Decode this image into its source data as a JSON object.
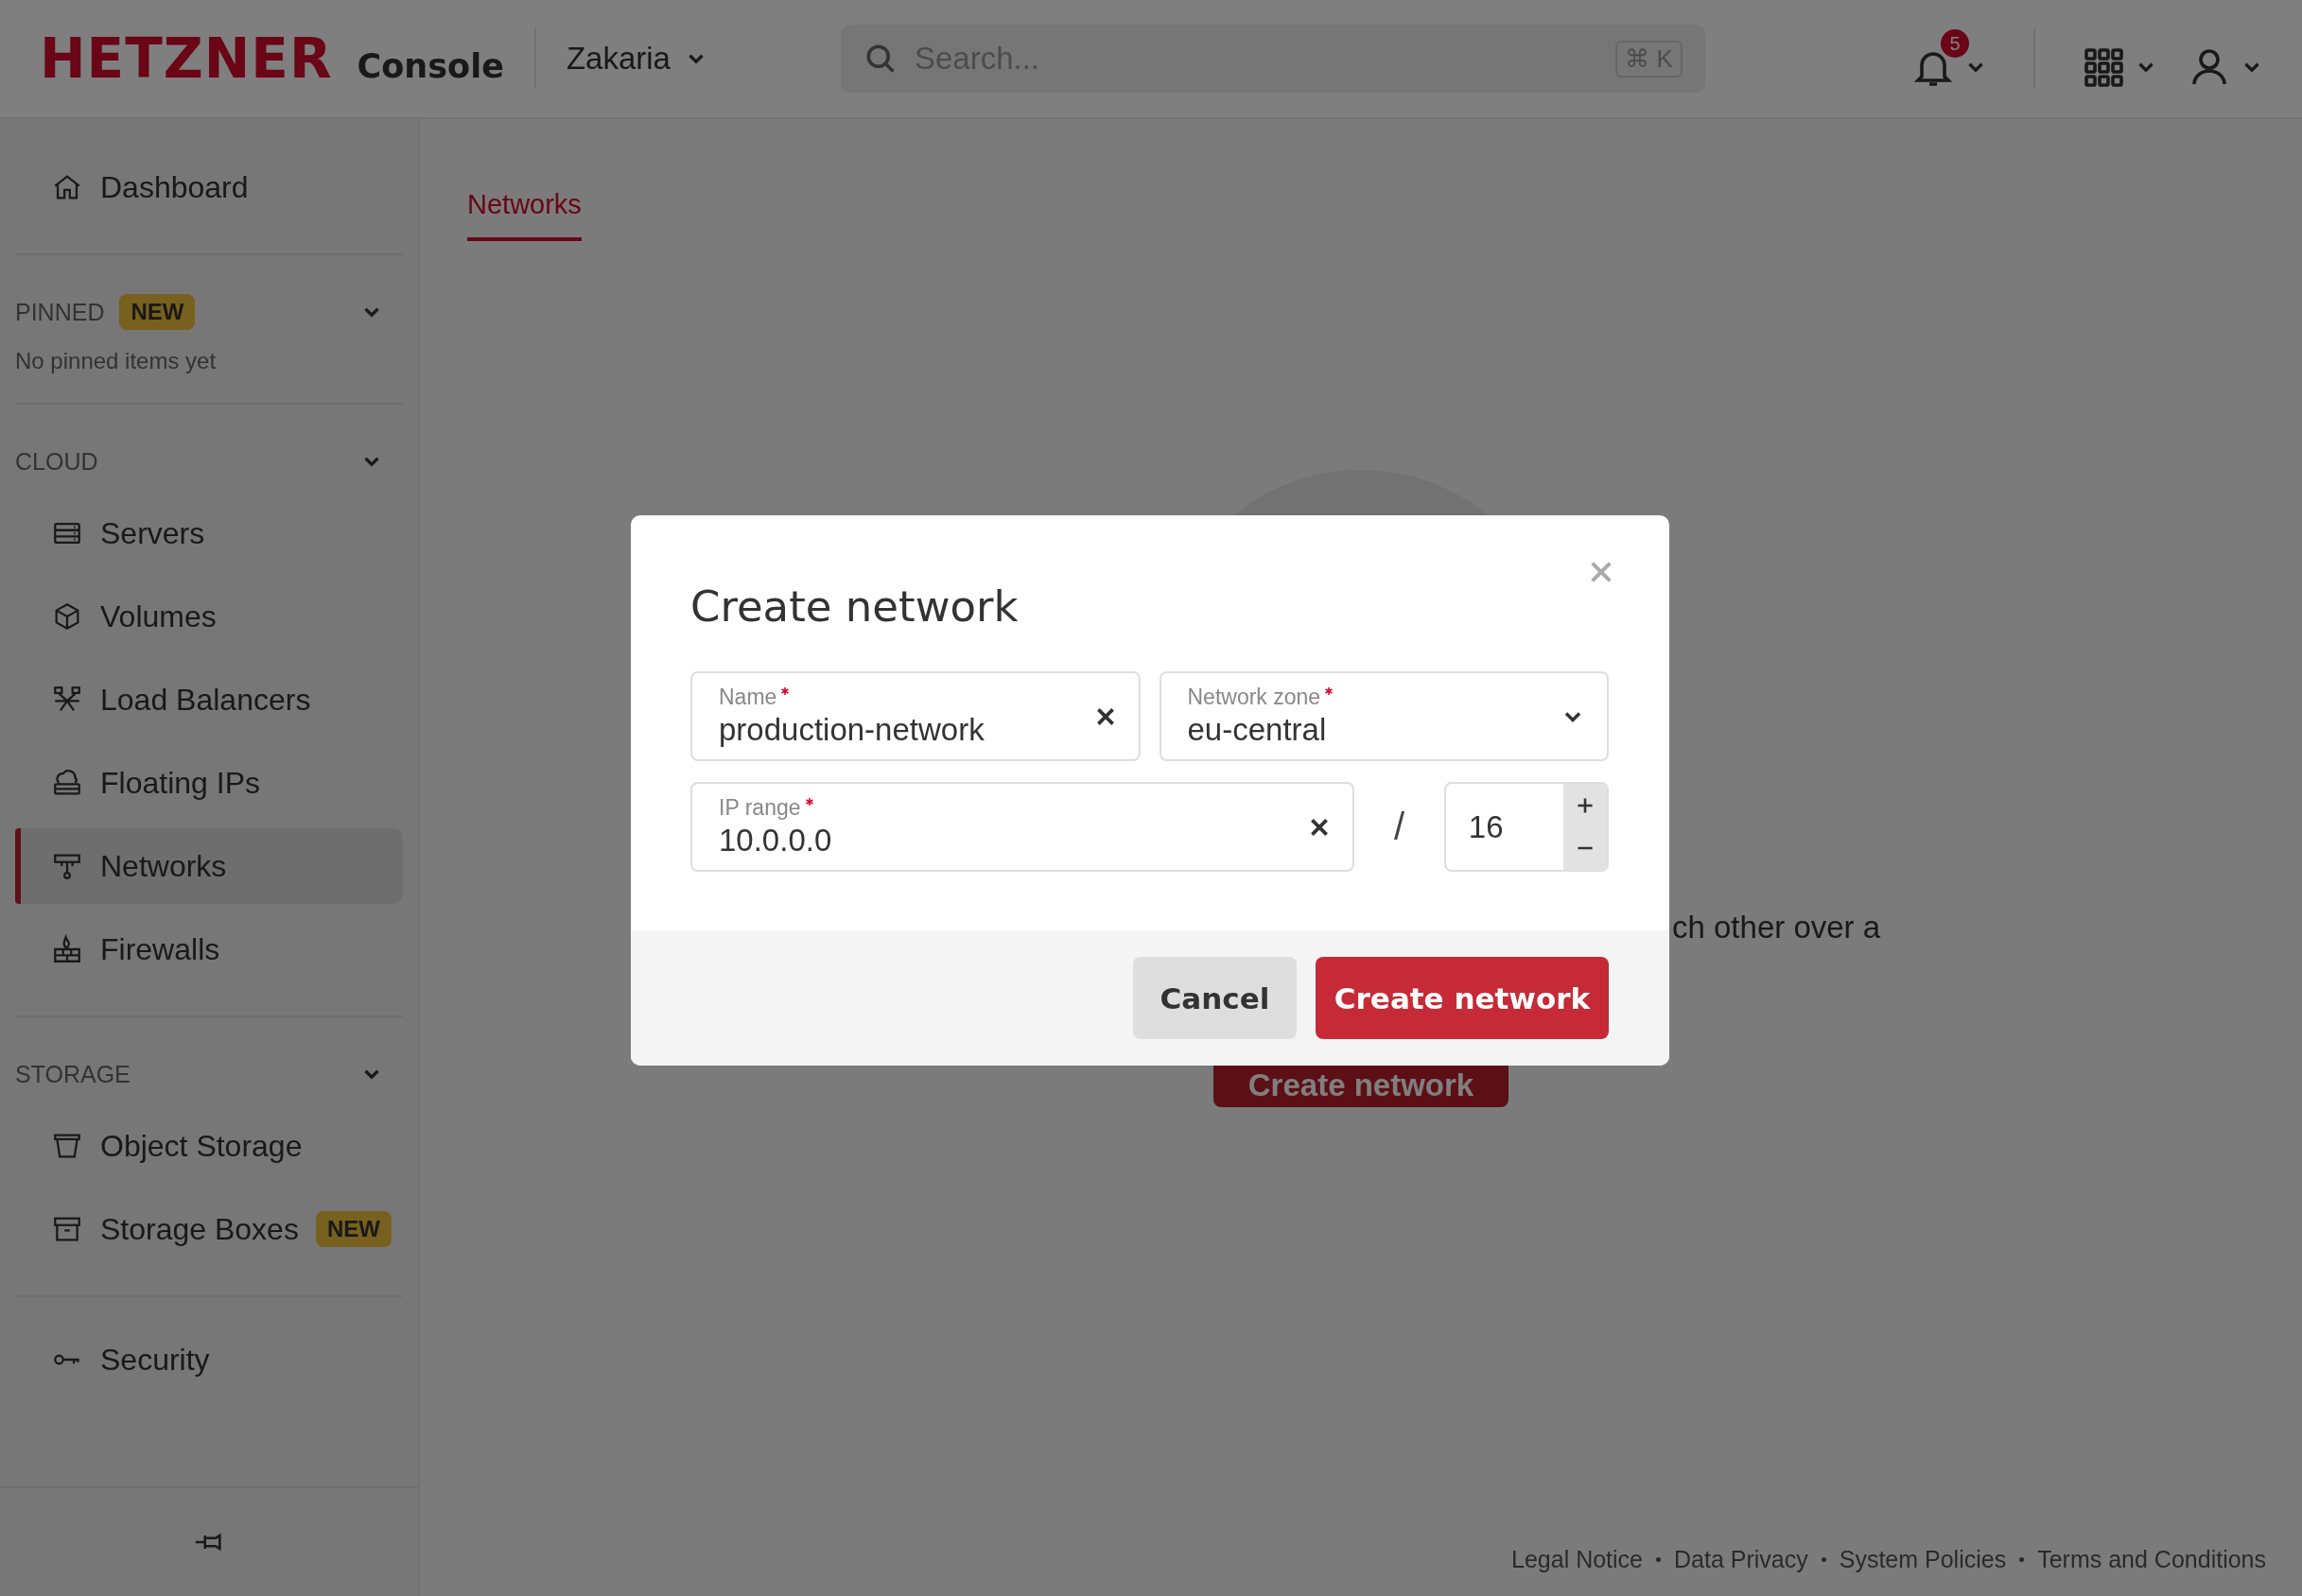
{
  "header": {
    "logo": "HETZNER",
    "product": "Console",
    "project": "Zakaria",
    "search": {
      "placeholder": "Search...",
      "shortcut": "⌘ K"
    },
    "notifications": "5"
  },
  "sidebar": {
    "groups": [
      {
        "kind": "plain",
        "items": [
          {
            "label": "Dashboard",
            "selected": false
          }
        ]
      },
      {
        "kind": "section",
        "title": "PINNED",
        "badge": "NEW",
        "expanded": true,
        "empty_text": "No pinned items yet"
      },
      {
        "kind": "section",
        "title": "CLOUD",
        "expanded": true,
        "items": [
          {
            "label": "Servers",
            "selected": false
          },
          {
            "label": "Volumes",
            "selected": false
          },
          {
            "label": "Load Balancers",
            "selected": false
          },
          {
            "label": "Floating IPs",
            "selected": false
          },
          {
            "label": "Networks",
            "selected": true
          },
          {
            "label": "Firewalls",
            "selected": false
          }
        ]
      },
      {
        "kind": "section",
        "title": "STORAGE",
        "expanded": true,
        "items": [
          {
            "label": "Object Storage",
            "selected": false
          },
          {
            "label": "Storage Boxes",
            "selected": false,
            "badge": "NEW"
          }
        ]
      },
      {
        "kind": "plain",
        "items": [
          {
            "label": "Security",
            "selected": false
          }
        ]
      }
    ]
  },
  "main": {
    "tabs": [
      {
        "label": "Networks",
        "selected": true
      }
    ],
    "empty_state": {
      "text": "ch other over a",
      "button": "Create network"
    },
    "footer_links": [
      "Legal Notice",
      "Data Privacy",
      "System Policies",
      "Terms and Conditions"
    ]
  },
  "modal": {
    "title": "Create network",
    "name_field": {
      "label": "Name",
      "required": true,
      "value": "production-network"
    },
    "zone_field": {
      "label": "Network zone",
      "required": true,
      "value": "eu-central"
    },
    "ip_field": {
      "label": "IP range",
      "required": true,
      "value": "10.0.0.0"
    },
    "separator": "/",
    "prefix_field": {
      "value": "16"
    },
    "buttons": {
      "cancel": "Cancel",
      "submit": "Create network"
    }
  }
}
